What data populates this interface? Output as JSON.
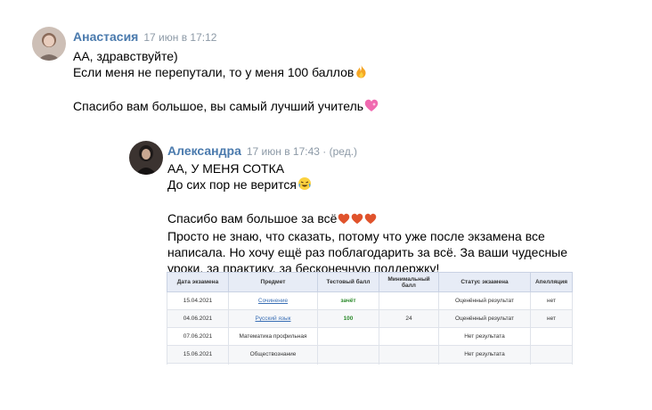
{
  "messages": [
    {
      "author": "Анастасия",
      "time": "17 июн в 17:12",
      "lines": [
        "АА, здравствуйте)",
        "Если меня не перепутали, то у меня 100 баллов",
        "",
        "Спасибо вам большое, вы самый лучший учитель"
      ],
      "emojis": [
        "fire-emoji",
        "heart-emoji"
      ]
    },
    {
      "author": "Александра",
      "time": "17 июн в 17:43 · (ред.)",
      "lines": [
        "АА, У МЕНЯ СОТКА",
        "До сих пор не верится",
        "",
        "Спасибо вам большое за всё",
        "Просто не знаю, что сказать, потому что уже после экзамена все",
        "написала. Но хочу ещё раз поблагодарить за всё. За ваши чудесные",
        "уроки, за практику, за бесконечную поддержку!"
      ],
      "emojis": [
        "crying-laughing-emoji",
        "heart-emoji",
        "heart-emoji",
        "heart-emoji"
      ]
    }
  ],
  "exam_table": {
    "headers": [
      "Дата экзамена",
      "Предмет",
      "Тестовый балл",
      "Минимальный балл",
      "Статус экзамена",
      "Апелляция"
    ],
    "rows": [
      [
        "15.04.2021",
        "Сочинение",
        "зачёт",
        "",
        "Оценённый результат",
        "нет"
      ],
      [
        "04.06.2021",
        "Русский язык",
        "100",
        "24",
        "Оценённый результат",
        "нет"
      ],
      [
        "07.06.2021",
        "Математика профильная",
        "",
        "",
        "Нет результата",
        ""
      ],
      [
        "15.06.2021",
        "Обществознание",
        "",
        "",
        "Нет результата",
        ""
      ]
    ]
  },
  "colors": {
    "author": "#4a7aad",
    "time": "#8c99a6",
    "table_header": "#e7ecf6",
    "score_green": "#2e8b2e",
    "link": "#3a6fb5"
  }
}
